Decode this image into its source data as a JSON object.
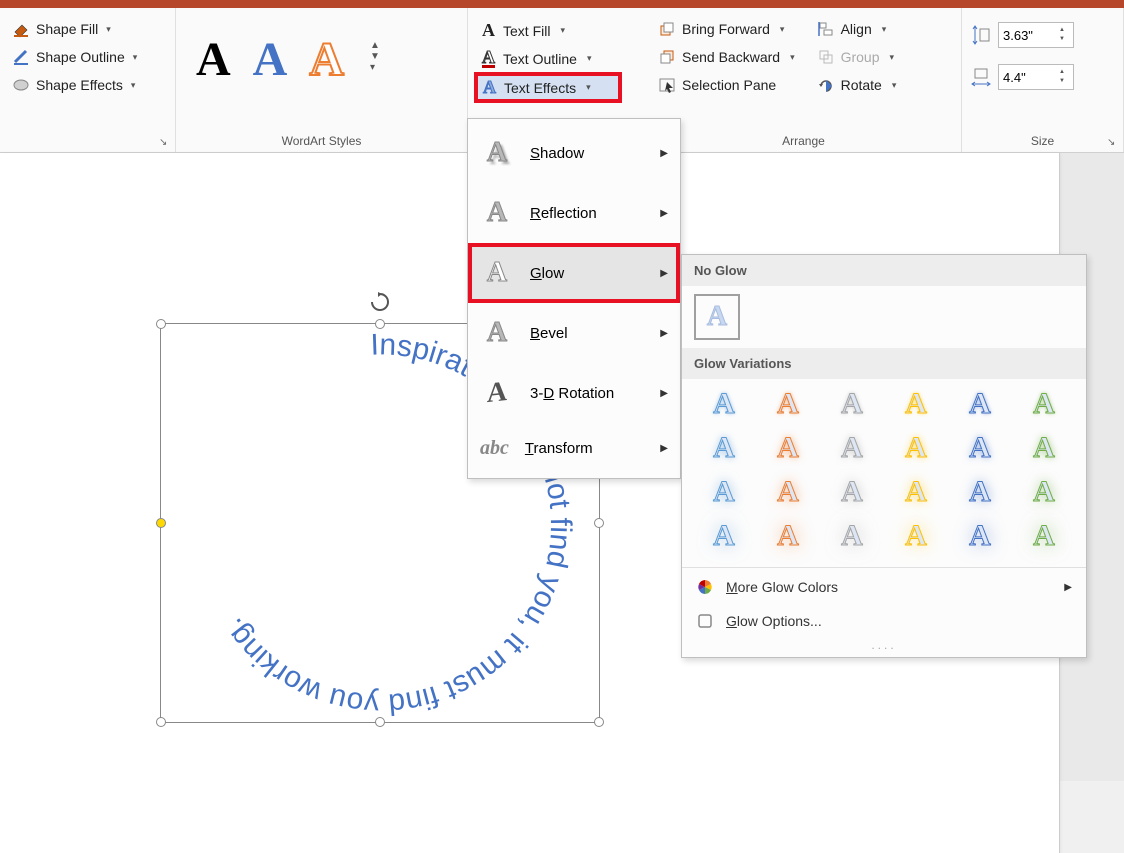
{
  "ribbon": {
    "shape_group": {
      "fill": "Shape Fill",
      "outline": "Shape Outline",
      "effects": "Shape Effects"
    },
    "wordart_label": "WordArt Styles",
    "text_group": {
      "fill": "Text Fill",
      "outline": "Text Outline",
      "effects": "Text Effects"
    },
    "arrange": {
      "label": "Arrange",
      "bring_forward": "Bring Forward",
      "send_backward": "Send Backward",
      "selection_pane": "Selection Pane",
      "align": "Align",
      "group": "Group",
      "rotate": "Rotate"
    },
    "size": {
      "label": "Size",
      "height": "3.63\"",
      "width": "4.4\""
    }
  },
  "text_effects_menu": {
    "shadow": "Shadow",
    "reflection": "Reflection",
    "glow": "Glow",
    "bevel": "Bevel",
    "rotation3d": "3-D Rotation",
    "transform": "Transform"
  },
  "glow_menu": {
    "no_glow": "No Glow",
    "variations": "Glow Variations",
    "more_colors": "More Glow Colors",
    "options": "Glow Options..."
  },
  "wordart_text": "Inspiration does not find you. It must find you working.",
  "glow_palette": [
    [
      "#5b9bd5",
      "#ed7d31",
      "#a5a5a5",
      "#ffc000",
      "#4472c4",
      "#70ad47"
    ],
    [
      "#5b9bd5",
      "#ed7d31",
      "#a5a5a5",
      "#ffc000",
      "#4472c4",
      "#70ad47"
    ],
    [
      "#5b9bd5",
      "#ed7d31",
      "#a5a5a5",
      "#ffc000",
      "#4472c4",
      "#70ad47"
    ],
    [
      "#5b9bd5",
      "#ed7d31",
      "#a5a5a5",
      "#ffc000",
      "#4472c4",
      "#70ad47"
    ]
  ],
  "glow_sizes": [
    4,
    8,
    12,
    18
  ]
}
